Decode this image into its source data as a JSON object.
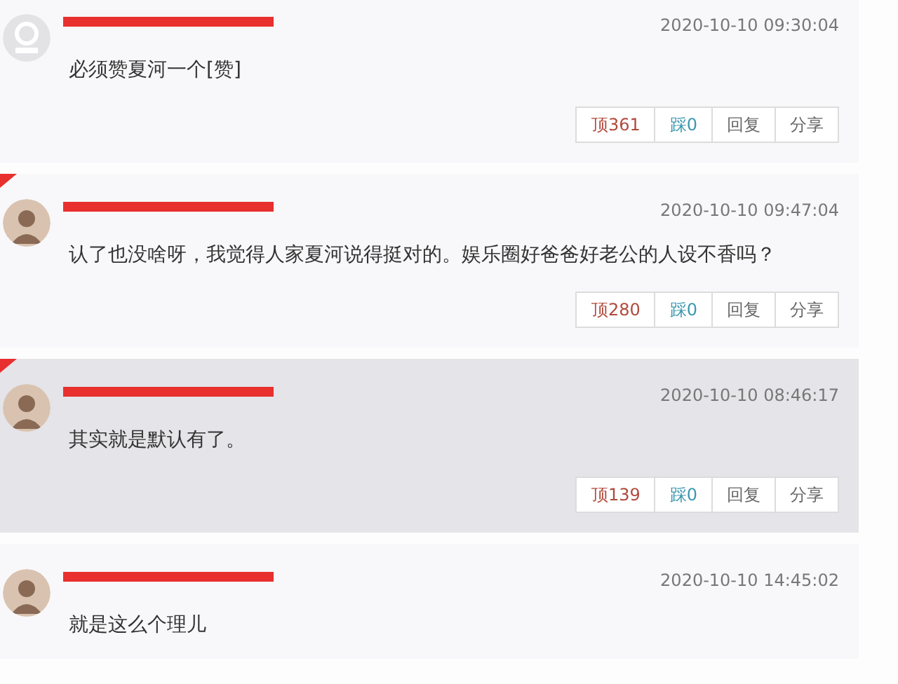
{
  "comments": [
    {
      "kind": "default",
      "marked": false,
      "redacted": true,
      "time": "2020-10-10 09:30:04",
      "text": "必须赞夏河一个[赞]",
      "highlighted": false,
      "buttons": [
        {
          "kind": "up",
          "label": "顶361"
        },
        {
          "kind": "down",
          "label": "踩0"
        },
        {
          "kind": "plain",
          "label": "回复"
        },
        {
          "kind": "plain",
          "label": "分享"
        }
      ]
    },
    {
      "kind": "photo",
      "marked": true,
      "redacted": true,
      "time": "2020-10-10 09:47:04",
      "text": "认了也没啥呀，我觉得人家夏河说得挺对的。娱乐圈好爸爸好老公的人设不香吗？",
      "highlighted": false,
      "buttons": [
        {
          "kind": "up",
          "label": "顶280"
        },
        {
          "kind": "down",
          "label": "踩0"
        },
        {
          "kind": "plain",
          "label": "回复"
        },
        {
          "kind": "plain",
          "label": "分享"
        }
      ]
    },
    {
      "kind": "photo",
      "marked": true,
      "redacted": true,
      "time": "2020-10-10 08:46:17",
      "text": "其实就是默认有了。",
      "highlighted": true,
      "buttons": [
        {
          "kind": "up",
          "label": "顶139"
        },
        {
          "kind": "down",
          "label": "踩0"
        },
        {
          "kind": "plain",
          "label": "回复"
        },
        {
          "kind": "plain",
          "label": "分享"
        }
      ]
    },
    {
      "kind": "photo",
      "marked": false,
      "redacted": true,
      "time": "2020-10-10 14:45:02",
      "text": "就是这么个理儿",
      "highlighted": false
    }
  ]
}
